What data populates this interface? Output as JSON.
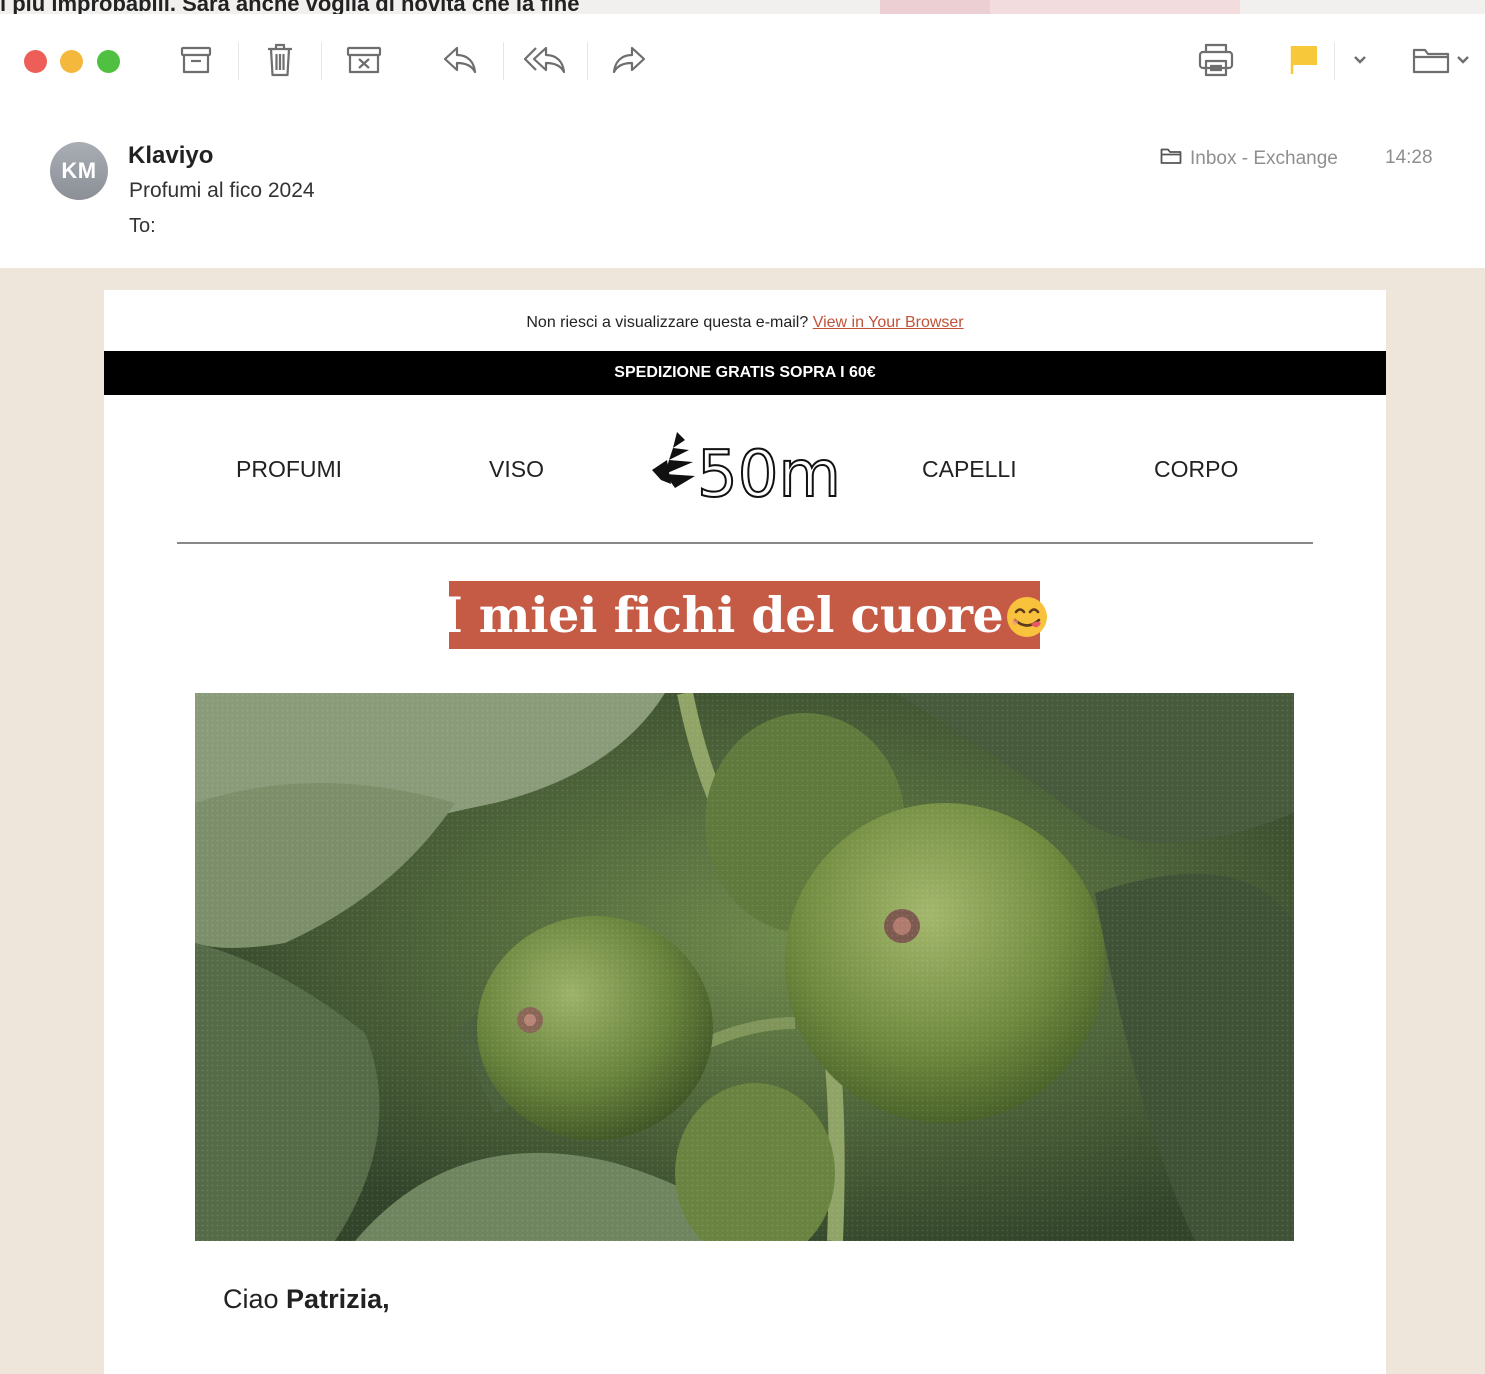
{
  "window": {
    "background_cut_text": "i più improbabili. Sarà anche voglia di novità che la fine"
  },
  "toolbar": {
    "archive_icon": "archive-icon",
    "trash_icon": "trash-icon",
    "junk_icon": "junk-icon",
    "reply_icon": "reply-icon",
    "reply_all_icon": "reply-all-icon",
    "forward_icon": "forward-icon",
    "print_icon": "print-icon",
    "flag_icon": "flag-icon",
    "flag_color": "#f7c83a",
    "folder_icon": "folder-icon"
  },
  "message": {
    "avatar_initials": "KM",
    "sender": "Klaviyo",
    "subject": "Profumi al fico 2024",
    "to_label": "To:",
    "to_value": "",
    "mailbox": "Inbox - Exchange",
    "time": "14:28"
  },
  "email": {
    "preheader_text": "Non riesci a visualizzare questa e-mail?",
    "preheader_link": "View in Your Browser",
    "shipping_banner": "SPEDIZIONE GRATIS SOPRA I 60€",
    "nav": [
      "PROFUMI",
      "VISO",
      "CAPELLI",
      "CORPO"
    ],
    "logo_text": "50ml",
    "headline": "I miei fichi del cuore",
    "headline_emoji": "face-savoring-food-emoji",
    "hero_image": "green-figs-on-tree-photo",
    "greeting_prefix": "Ciao",
    "greeting_name": "Patrizia,",
    "accent_color": "#c55a45",
    "link_color": "#c0533a"
  }
}
